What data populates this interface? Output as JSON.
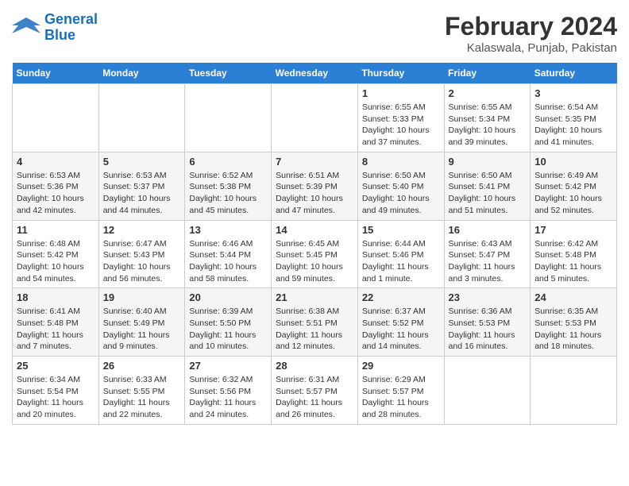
{
  "logo": {
    "text_general": "General",
    "text_blue": "Blue"
  },
  "title": "February 2024",
  "subtitle": "Kalaswala, Punjab, Pakistan",
  "headers": [
    "Sunday",
    "Monday",
    "Tuesday",
    "Wednesday",
    "Thursday",
    "Friday",
    "Saturday"
  ],
  "weeks": [
    [
      {
        "day": "",
        "info": ""
      },
      {
        "day": "",
        "info": ""
      },
      {
        "day": "",
        "info": ""
      },
      {
        "day": "",
        "info": ""
      },
      {
        "day": "1",
        "info": "Sunrise: 6:55 AM\nSunset: 5:33 PM\nDaylight: 10 hours\nand 37 minutes."
      },
      {
        "day": "2",
        "info": "Sunrise: 6:55 AM\nSunset: 5:34 PM\nDaylight: 10 hours\nand 39 minutes."
      },
      {
        "day": "3",
        "info": "Sunrise: 6:54 AM\nSunset: 5:35 PM\nDaylight: 10 hours\nand 41 minutes."
      }
    ],
    [
      {
        "day": "4",
        "info": "Sunrise: 6:53 AM\nSunset: 5:36 PM\nDaylight: 10 hours\nand 42 minutes."
      },
      {
        "day": "5",
        "info": "Sunrise: 6:53 AM\nSunset: 5:37 PM\nDaylight: 10 hours\nand 44 minutes."
      },
      {
        "day": "6",
        "info": "Sunrise: 6:52 AM\nSunset: 5:38 PM\nDaylight: 10 hours\nand 45 minutes."
      },
      {
        "day": "7",
        "info": "Sunrise: 6:51 AM\nSunset: 5:39 PM\nDaylight: 10 hours\nand 47 minutes."
      },
      {
        "day": "8",
        "info": "Sunrise: 6:50 AM\nSunset: 5:40 PM\nDaylight: 10 hours\nand 49 minutes."
      },
      {
        "day": "9",
        "info": "Sunrise: 6:50 AM\nSunset: 5:41 PM\nDaylight: 10 hours\nand 51 minutes."
      },
      {
        "day": "10",
        "info": "Sunrise: 6:49 AM\nSunset: 5:42 PM\nDaylight: 10 hours\nand 52 minutes."
      }
    ],
    [
      {
        "day": "11",
        "info": "Sunrise: 6:48 AM\nSunset: 5:42 PM\nDaylight: 10 hours\nand 54 minutes."
      },
      {
        "day": "12",
        "info": "Sunrise: 6:47 AM\nSunset: 5:43 PM\nDaylight: 10 hours\nand 56 minutes."
      },
      {
        "day": "13",
        "info": "Sunrise: 6:46 AM\nSunset: 5:44 PM\nDaylight: 10 hours\nand 58 minutes."
      },
      {
        "day": "14",
        "info": "Sunrise: 6:45 AM\nSunset: 5:45 PM\nDaylight: 10 hours\nand 59 minutes."
      },
      {
        "day": "15",
        "info": "Sunrise: 6:44 AM\nSunset: 5:46 PM\nDaylight: 11 hours\nand 1 minute."
      },
      {
        "day": "16",
        "info": "Sunrise: 6:43 AM\nSunset: 5:47 PM\nDaylight: 11 hours\nand 3 minutes."
      },
      {
        "day": "17",
        "info": "Sunrise: 6:42 AM\nSunset: 5:48 PM\nDaylight: 11 hours\nand 5 minutes."
      }
    ],
    [
      {
        "day": "18",
        "info": "Sunrise: 6:41 AM\nSunset: 5:48 PM\nDaylight: 11 hours\nand 7 minutes."
      },
      {
        "day": "19",
        "info": "Sunrise: 6:40 AM\nSunset: 5:49 PM\nDaylight: 11 hours\nand 9 minutes."
      },
      {
        "day": "20",
        "info": "Sunrise: 6:39 AM\nSunset: 5:50 PM\nDaylight: 11 hours\nand 10 minutes."
      },
      {
        "day": "21",
        "info": "Sunrise: 6:38 AM\nSunset: 5:51 PM\nDaylight: 11 hours\nand 12 minutes."
      },
      {
        "day": "22",
        "info": "Sunrise: 6:37 AM\nSunset: 5:52 PM\nDaylight: 11 hours\nand 14 minutes."
      },
      {
        "day": "23",
        "info": "Sunrise: 6:36 AM\nSunset: 5:53 PM\nDaylight: 11 hours\nand 16 minutes."
      },
      {
        "day": "24",
        "info": "Sunrise: 6:35 AM\nSunset: 5:53 PM\nDaylight: 11 hours\nand 18 minutes."
      }
    ],
    [
      {
        "day": "25",
        "info": "Sunrise: 6:34 AM\nSunset: 5:54 PM\nDaylight: 11 hours\nand 20 minutes."
      },
      {
        "day": "26",
        "info": "Sunrise: 6:33 AM\nSunset: 5:55 PM\nDaylight: 11 hours\nand 22 minutes."
      },
      {
        "day": "27",
        "info": "Sunrise: 6:32 AM\nSunset: 5:56 PM\nDaylight: 11 hours\nand 24 minutes."
      },
      {
        "day": "28",
        "info": "Sunrise: 6:31 AM\nSunset: 5:57 PM\nDaylight: 11 hours\nand 26 minutes."
      },
      {
        "day": "29",
        "info": "Sunrise: 6:29 AM\nSunset: 5:57 PM\nDaylight: 11 hours\nand 28 minutes."
      },
      {
        "day": "",
        "info": ""
      },
      {
        "day": "",
        "info": ""
      }
    ]
  ]
}
